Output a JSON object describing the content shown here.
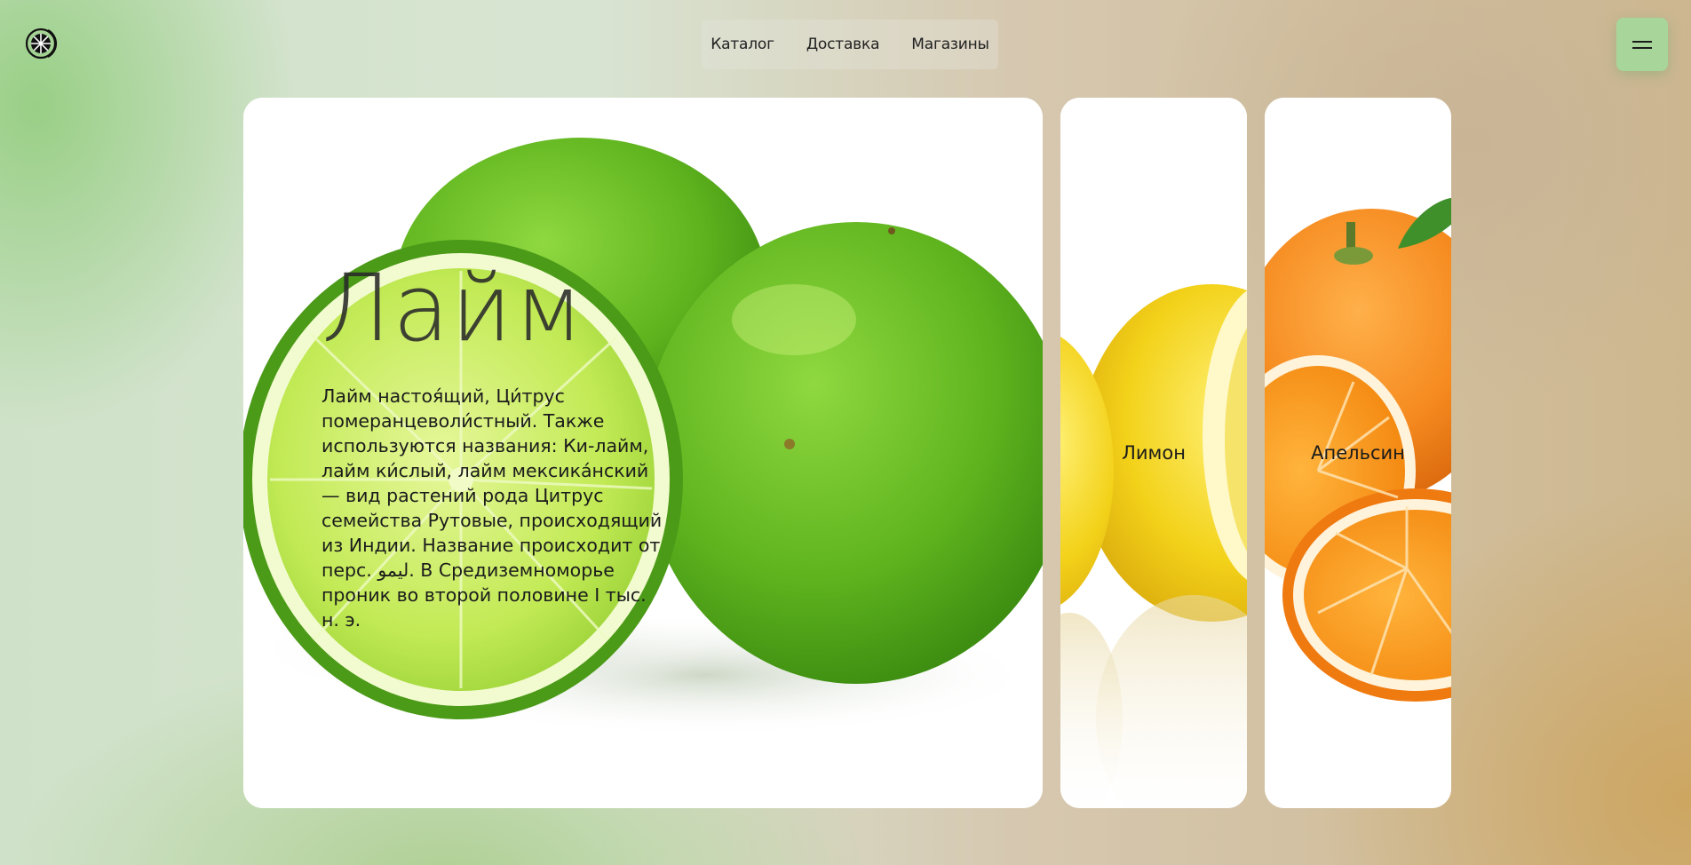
{
  "logo": {
    "icon": "citrus-slice-icon"
  },
  "nav": {
    "items": [
      {
        "label": "Каталог"
      },
      {
        "label": "Доставка"
      },
      {
        "label": "Магазины"
      }
    ]
  },
  "menu": {
    "icon": "hamburger-icon"
  },
  "main_card": {
    "title": "Лайм",
    "description": "Лайм настоя́щий, Ци́трус померанцеволи́стный. Также используются названия: Ки-лайм, лайм ки́слый, лайм мексика́нский — вид растений рода Цитрус семейства Рутовые, происходящий из Индии. Название происходит от перс. لیمو. В Средиземноморье проник во второй половине I тыс. н. э."
  },
  "side_cards": [
    {
      "label": "Лимон"
    },
    {
      "label": "Апельсин"
    }
  ],
  "colors": {
    "accent": "#a8d69a",
    "lime": "#7cc52e",
    "lemon": "#f5d21a",
    "orange": "#f58a1f",
    "text": "#1b1b1b"
  }
}
